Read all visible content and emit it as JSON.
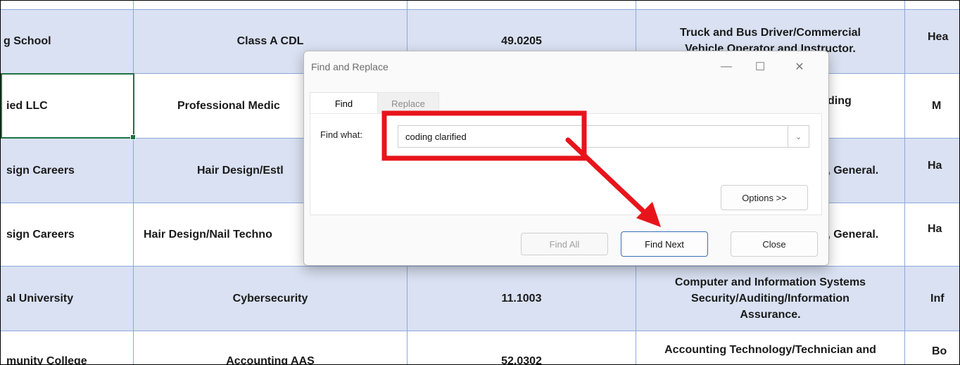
{
  "table": {
    "rows": [
      {
        "cells": [
          "g School",
          "Class A CDL",
          "49.0205",
          "Truck and Bus Driver/Commercial\nVehicle Operator and Instructor.",
          "Hea"
        ]
      },
      {
        "cells": [
          "ied LLC",
          "Professional Medic",
          "",
          "ding",
          "M"
        ]
      },
      {
        "cells": [
          "sign Careers",
          "Hair Design/Estl",
          "",
          "t, General.",
          "Ha"
        ]
      },
      {
        "cells": [
          "sign Careers",
          "Hair Design/Nail Techno",
          "",
          "t, General.",
          "Ha"
        ]
      },
      {
        "cells": [
          "al University",
          "Cybersecurity",
          "11.1003",
          "Computer and Information Systems\nSecurity/Auditing/Information\nAssurance.",
          "Inf"
        ]
      },
      {
        "cells": [
          "munity College",
          "Accounting AAS",
          "52.0302",
          "Accounting Technology/Technician and",
          "Bo"
        ]
      }
    ]
  },
  "dialog": {
    "title": "Find and Replace",
    "tabs": {
      "find": "Find",
      "replace": "Replace"
    },
    "find_label": "Find what:",
    "find_value": "coding clarified",
    "buttons": {
      "options": "Options >>",
      "find_all": "Find All",
      "find_next": "Find Next",
      "close": "Close"
    },
    "window_controls": {
      "minimize": "—",
      "maximize": "☐",
      "close": "✕"
    }
  },
  "annotation": {
    "color": "#e8141b"
  },
  "colors": {
    "band": "#d9e1f2",
    "grid": "#8ea9db",
    "selection": "#1e7145"
  }
}
